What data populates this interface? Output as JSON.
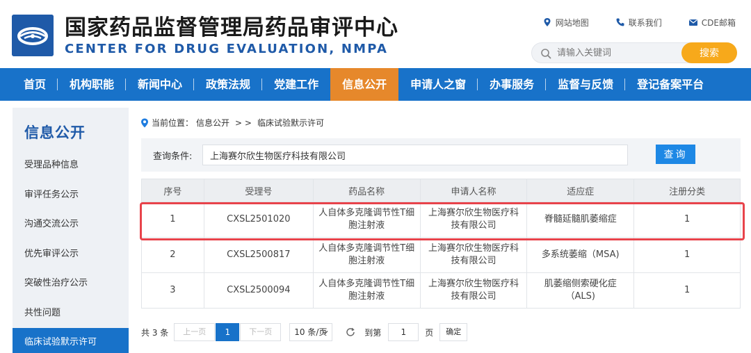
{
  "header": {
    "title_cn": "国家药品监督管理局药品审评中心",
    "title_en": "CENTER FOR DRUG EVALUATION, NMPA",
    "top_links": [
      {
        "label": "网站地图",
        "icon": "map-pin-icon"
      },
      {
        "label": "联系我们",
        "icon": "phone-icon"
      },
      {
        "label": "CDE邮箱",
        "icon": "mail-icon"
      }
    ],
    "search": {
      "placeholder": "请输入关键词",
      "value": "",
      "button": "搜索"
    },
    "colors": {
      "brand_blue": "#1f5aa8",
      "nav_blue": "#1872c9",
      "active_orange": "#e6882b",
      "search_orange": "#f7a91b"
    }
  },
  "nav": {
    "items": [
      "首页",
      "机构职能",
      "新闻中心",
      "政策法规",
      "党建工作",
      "信息公开",
      "申请人之窗",
      "办事服务",
      "监督与反馈",
      "登记备案平台"
    ],
    "active": "信息公开"
  },
  "sidebar": {
    "title": "信息公开",
    "items": [
      "受理品种信息",
      "审评任务公示",
      "沟通交流公示",
      "优先审评公示",
      "突破性治疗公示",
      "共性问题",
      "临床试验默示许可"
    ],
    "active": "临床试验默示许可"
  },
  "breadcrumb": {
    "prefix": "当前位置：",
    "section": "信息公开",
    "separator": "> >",
    "current": "临床试验默示许可"
  },
  "query": {
    "label": "查询条件:",
    "value": "上海赛尔欣生物医疗科技有限公司",
    "button": "查询"
  },
  "table": {
    "headers": [
      "序号",
      "受理号",
      "药品名称",
      "申请人名称",
      "适应症",
      "注册分类"
    ],
    "rows": [
      {
        "no": "1",
        "acceptance": "CXSL2501020",
        "drug": "人自体多克隆调节性T细胞注射液",
        "applicant": "上海赛尔欣生物医疗科技有限公司",
        "indication": "脊髓延髓肌萎缩症",
        "category": "1"
      },
      {
        "no": "2",
        "acceptance": "CXSL2500817",
        "drug": "人自体多克隆调节性T细胞注射液",
        "applicant": "上海赛尔欣生物医疗科技有限公司",
        "indication": "多系统萎缩（MSA)",
        "category": "1"
      },
      {
        "no": "3",
        "acceptance": "CXSL2500094",
        "drug": "人自体多克隆调节性T细胞注射液",
        "applicant": "上海赛尔欣生物医疗科技有限公司",
        "indication": "肌萎缩侧索硬化症（ALS)",
        "category": "1"
      }
    ],
    "highlighted_row": 1,
    "highlight_color": "#e8434b"
  },
  "pagination": {
    "total": "共 3 条",
    "prev": "上一页",
    "current_page": "1",
    "next": "下一页",
    "page_size": "10 条/页",
    "goto_label": "到第",
    "goto_value": "1",
    "page_label": "页",
    "confirm": "确定"
  }
}
